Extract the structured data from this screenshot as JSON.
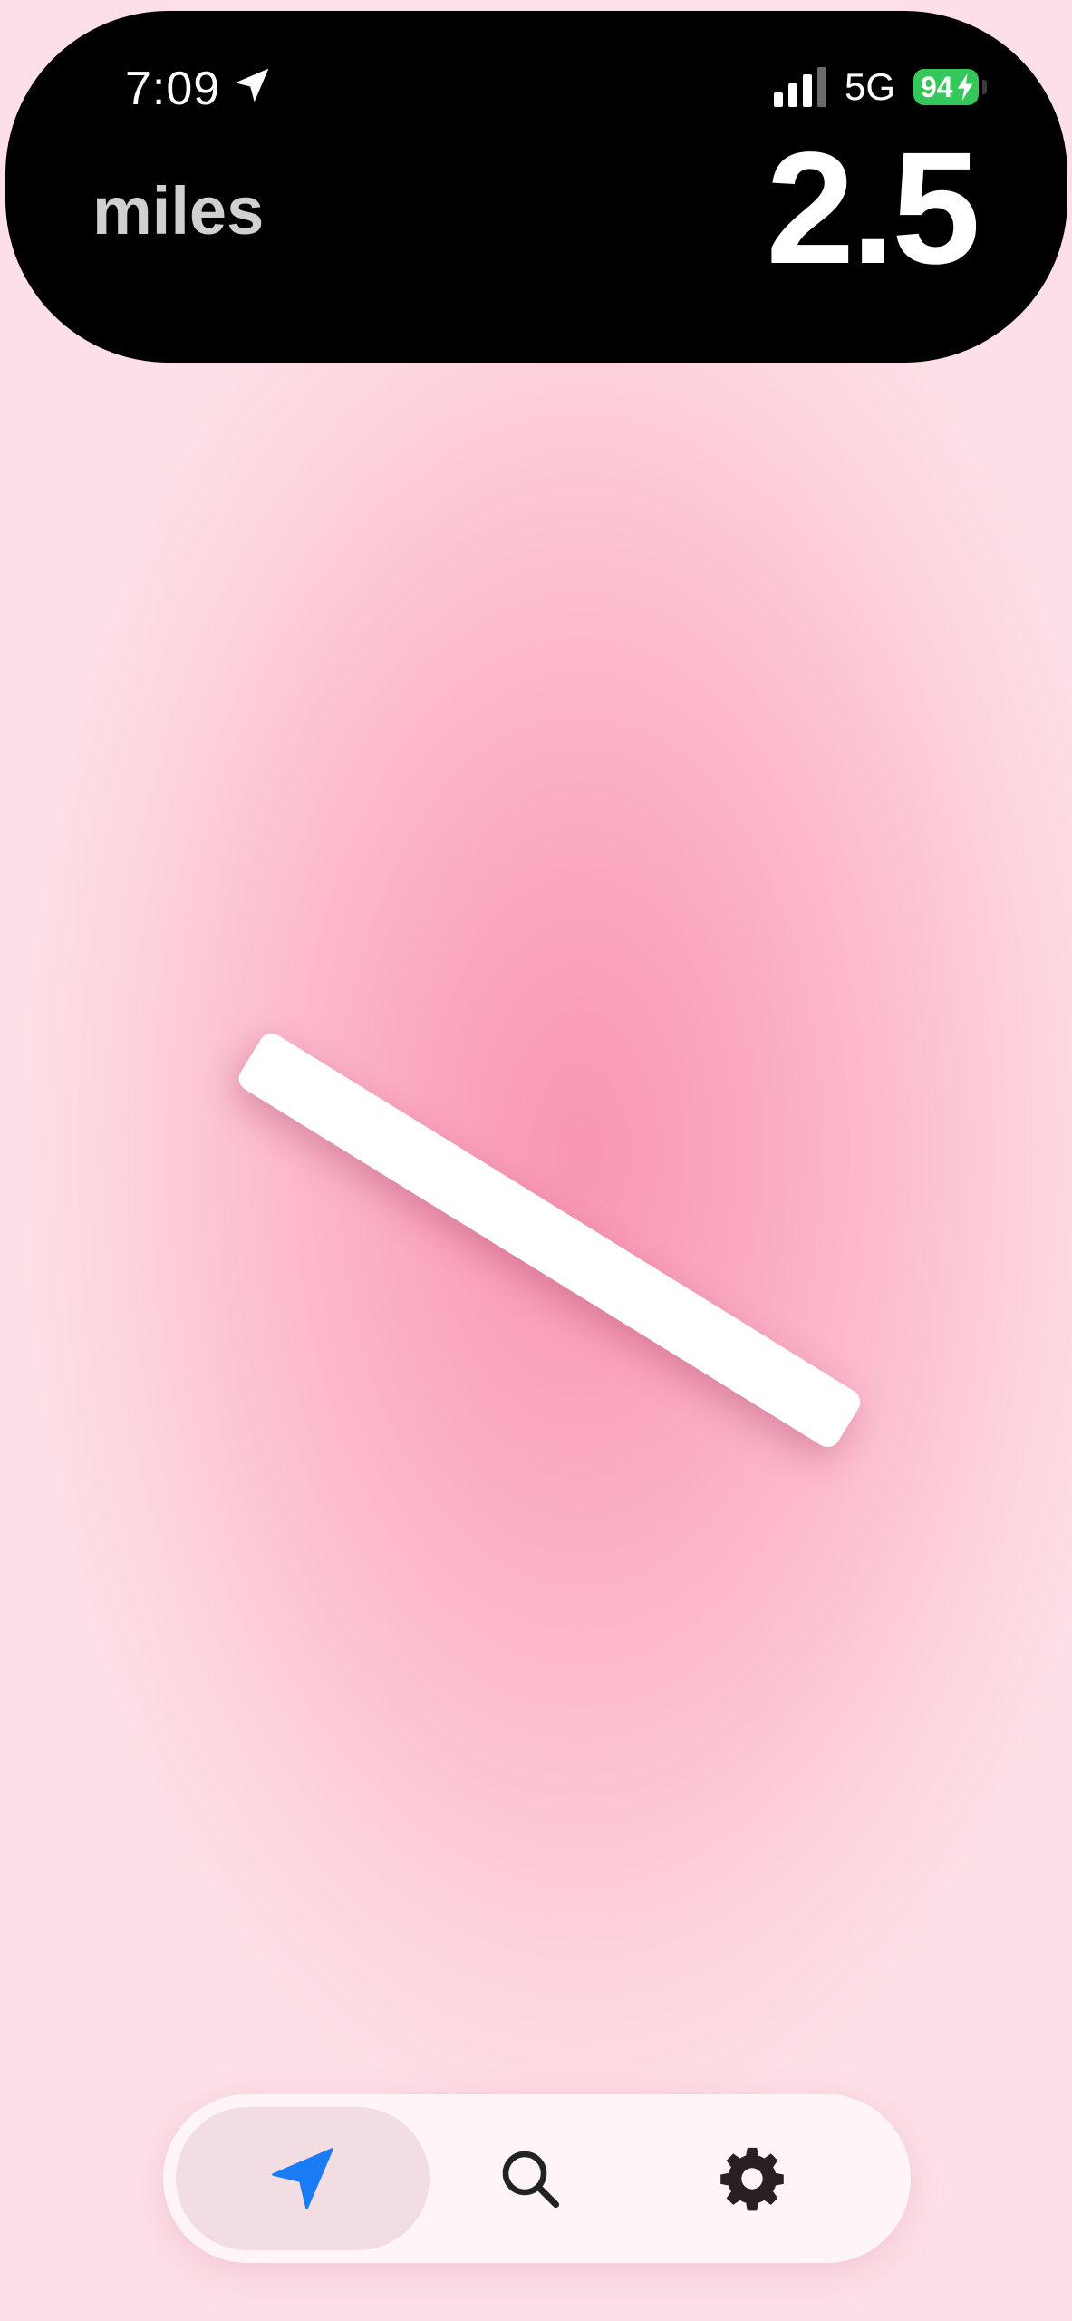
{
  "status_bar": {
    "time": "7:09",
    "network": "5G",
    "battery": "94"
  },
  "header": {
    "unit_label": "miles",
    "distance_value": "2.5"
  },
  "icons": {
    "status_location": "location-arrow-icon",
    "signal": "signal-bars-icon",
    "battery_charging": "lightning-bolt-icon",
    "nav": "navigation-arrow-icon",
    "search": "search-icon",
    "settings": "gear-icon"
  },
  "colors": {
    "accent_blue": "#1a7cf5",
    "battery_green": "#34c759",
    "background_pink": "#f996b1",
    "pill_black": "#000000"
  }
}
